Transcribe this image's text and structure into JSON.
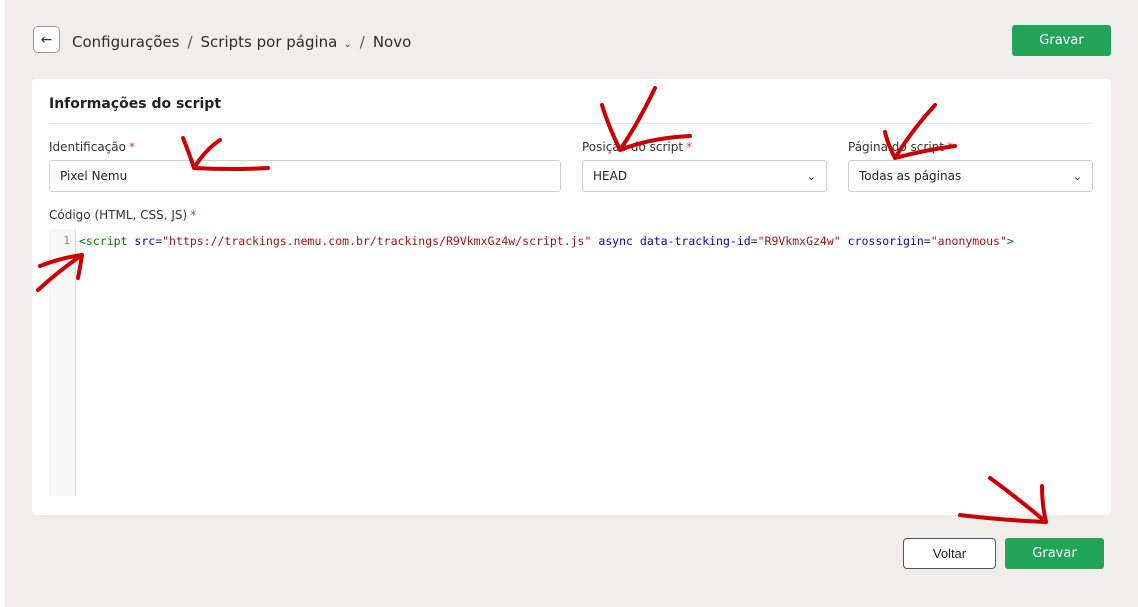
{
  "header": {
    "breadcrumb": {
      "item1": "Configurações",
      "item2": "Scripts por página",
      "item3": "Novo",
      "separator": "/"
    },
    "save_label": "Gravar"
  },
  "card": {
    "title": "Informações do script",
    "identificacao": {
      "label": "Identificação",
      "value": "Pixel Nemu"
    },
    "posicao": {
      "label": "Posição do script",
      "value": "HEAD"
    },
    "pagina": {
      "label": "Página do script",
      "value": "Todas as páginas"
    },
    "codigo": {
      "label": "Código (HTML, CSS, JS)",
      "line_number": "1",
      "tokens": {
        "open": "<script",
        "attr_src": "src",
        "eq": "=",
        "val_src": "\"https://trackings.nemu.com.br/trackings/R9VkmxGz4w/script.js\"",
        "attr_async": "async",
        "attr_tracking": "data-tracking-id",
        "val_tracking": "\"R9VkmxGz4w\"",
        "attr_cross": "crossorigin",
        "val_cross": "\"anonymous\"",
        "close": ">"
      }
    }
  },
  "footer": {
    "back_label": "Voltar",
    "save_label": "Gravar"
  },
  "icons": {
    "back": "arrow-left-icon",
    "dropdown": "chevron-down-icon"
  },
  "colors": {
    "primary": "#22a45a",
    "required": "#d23b3b",
    "annotation": "#cc0000",
    "background": "#f0eeeb"
  }
}
